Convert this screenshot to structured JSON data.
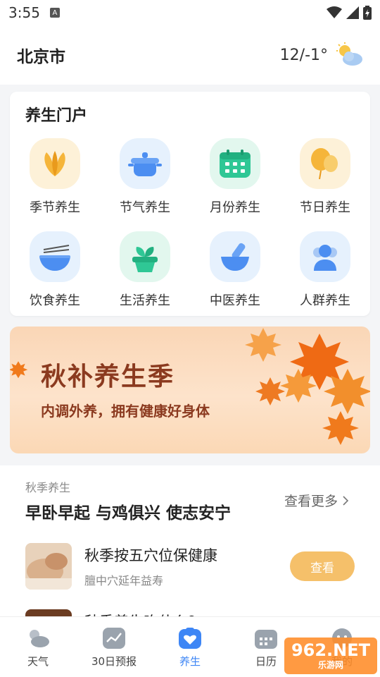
{
  "status": {
    "time": "3:55",
    "notif": "A"
  },
  "header": {
    "city": "北京市",
    "temp": "12/-1°"
  },
  "portal": {
    "title": "养生门户",
    "items": [
      {
        "label": "季节养生",
        "icon": "leaf-icon"
      },
      {
        "label": "节气养生",
        "icon": "pot-icon"
      },
      {
        "label": "月份养生",
        "icon": "calendar-icon"
      },
      {
        "label": "节日养生",
        "icon": "balloon-icon"
      },
      {
        "label": "饮食养生",
        "icon": "bowl-chopsticks-icon"
      },
      {
        "label": "生活养生",
        "icon": "sprout-pot-icon"
      },
      {
        "label": "中医养生",
        "icon": "mortar-icon"
      },
      {
        "label": "人群养生",
        "icon": "people-icon"
      }
    ]
  },
  "banner": {
    "title": "秋补养生季",
    "subtitle": "内调外养，拥有健康好身体"
  },
  "section": {
    "tag": "秋季养生",
    "heading": "早卧早起 与鸡俱兴 使志安宁",
    "more": "查看更多",
    "articles": [
      {
        "title": "秋季按五穴位保健康",
        "subtitle": "膻中穴延年益寿",
        "button": "查看"
      },
      {
        "title": "秋季养生吃什么？",
        "subtitle": "",
        "button": ""
      }
    ]
  },
  "tabs": [
    {
      "label": "天气",
      "icon": "weather-icon"
    },
    {
      "label": "30日预报",
      "icon": "trend-icon"
    },
    {
      "label": "养生",
      "icon": "health-icon"
    },
    {
      "label": "日历",
      "icon": "calendar-icon"
    },
    {
      "label": "我的",
      "icon": "profile-icon"
    }
  ],
  "watermark": {
    "main": "962.NET",
    "sub": "乐游网"
  },
  "colors": {
    "accent": "#3e86f5",
    "button": "#f5c06a",
    "banner_text": "#8b3a1f"
  }
}
